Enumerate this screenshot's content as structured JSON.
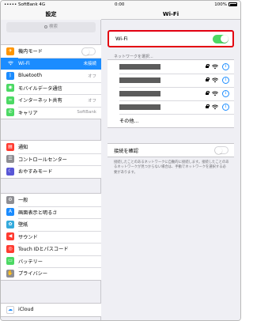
{
  "status_bar": {
    "carrier": "SoftBank",
    "network": "4G",
    "time": "0:00",
    "battery": "100%"
  },
  "settings_pane": {
    "title": "設定",
    "search_placeholder": "検索",
    "groups": [
      [
        {
          "label": "機内モード",
          "icon": "airplane-icon",
          "color": "#ff9500",
          "control": "toggle-off"
        },
        {
          "label": "Wi-Fi",
          "icon": "wifi-icon",
          "color": "#1b8cff",
          "value": "未接続",
          "selected": true
        },
        {
          "label": "Bluetooth",
          "icon": "bluetooth-icon",
          "color": "#1b8cff",
          "value": "オフ"
        },
        {
          "label": "モバイルデータ通信",
          "icon": "antenna-icon",
          "color": "#4cd964"
        },
        {
          "label": "インターネット共有",
          "icon": "link-icon",
          "color": "#4cd964",
          "value": "オフ"
        },
        {
          "label": "キャリア",
          "icon": "phone-icon",
          "color": "#4cd964",
          "value": "SoftBank"
        }
      ],
      [
        {
          "label": "通知",
          "icon": "notification-icon",
          "color": "#ff3b30"
        },
        {
          "label": "コントロールセンター",
          "icon": "control-center-icon",
          "color": "#8e8e93"
        },
        {
          "label": "おやすみモード",
          "icon": "moon-icon",
          "color": "#5856d6"
        }
      ],
      [
        {
          "label": "一般",
          "icon": "gear-icon",
          "color": "#8e8e93"
        },
        {
          "label": "画面表示と明るさ",
          "icon": "brightness-icon",
          "color": "#1b8cff"
        },
        {
          "label": "壁紙",
          "icon": "wallpaper-icon",
          "color": "#34aadc"
        },
        {
          "label": "サウンド",
          "icon": "speaker-icon",
          "color": "#ff3b30"
        },
        {
          "label": "Touch IDとパスコード",
          "icon": "fingerprint-icon",
          "color": "#ff3b30"
        },
        {
          "label": "バッテリー",
          "icon": "battery-icon",
          "color": "#4cd964"
        },
        {
          "label": "プライバシー",
          "icon": "hand-icon",
          "color": "#8e8e93"
        }
      ],
      [
        {
          "label": "iCloud",
          "icon": "cloud-icon",
          "color": "#ffffff"
        }
      ]
    ]
  },
  "wifi_pane": {
    "title": "Wi-Fi",
    "wifi_label": "Wi-Fi",
    "wifi_on": true,
    "networks_caption": "ネットワークを選択...",
    "networks": [
      {
        "name": "",
        "locked": true
      },
      {
        "name": "",
        "locked": true
      },
      {
        "name": "",
        "locked": true
      },
      {
        "name": "",
        "locked": true
      }
    ],
    "other_label": "その他...",
    "ask_label": "接続を確認",
    "ask_on": false,
    "ask_note": "接続したことのあるネットワークに自動的に接続します。接続したことのあるネットワークが見つからない場合は、手動でネットワークを選択する必要があります。",
    "info_glyph": "i"
  },
  "accent_colors": {
    "blue": "#1b8cff",
    "green": "#4cd964",
    "highlight_border": "#e30010"
  }
}
